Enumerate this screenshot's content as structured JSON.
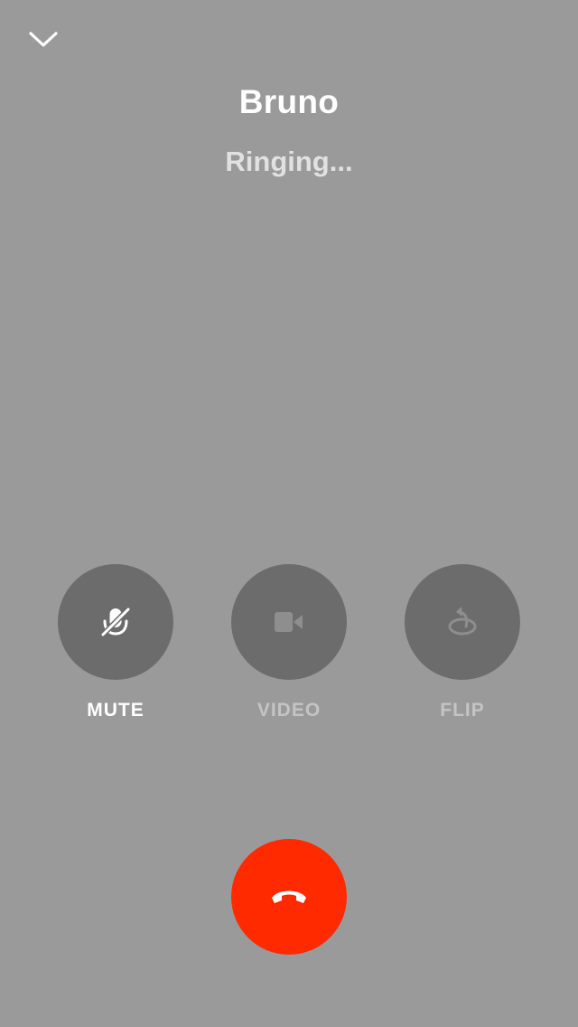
{
  "call": {
    "caller_name": "Bruno",
    "status": "Ringing..."
  },
  "controls": {
    "mute": {
      "label": "MUTE",
      "icon": "mic-off-icon",
      "enabled": true
    },
    "video": {
      "label": "VIDEO",
      "icon": "video-camera-icon",
      "enabled": false
    },
    "flip": {
      "label": "FLIP",
      "icon": "flip-camera-icon",
      "enabled": false
    }
  },
  "actions": {
    "collapse_icon": "chevron-down-icon",
    "end_call_icon": "hang-up-icon"
  },
  "colors": {
    "background": "#9a9a9a",
    "control_circle": "#6c6c6c",
    "end_call": "#ff2a00",
    "text_primary": "#ffffff",
    "text_secondary": "#e1e1e1",
    "text_disabled": "#c4c4c4"
  }
}
